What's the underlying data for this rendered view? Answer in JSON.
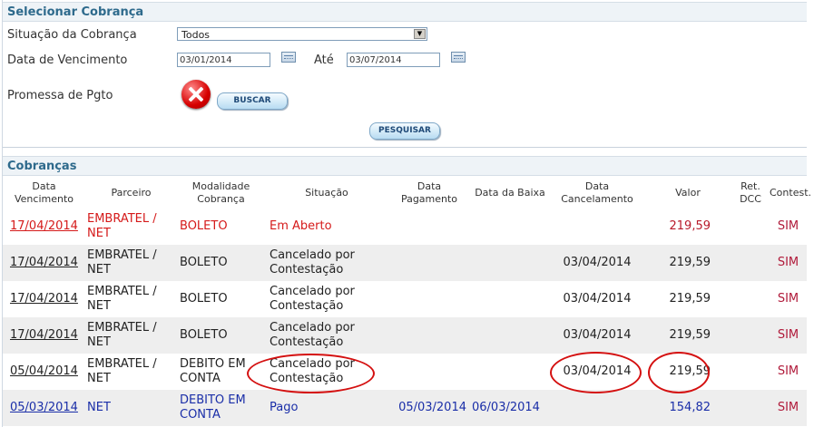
{
  "select_section": {
    "title": "Selecionar Cobrança",
    "situacao_label": "Situação da Cobrança",
    "situacao_value": "Todos",
    "vencimento_label": "Data de Vencimento",
    "vencimento_de": "03/01/2014",
    "ate_label": "Até",
    "vencimento_ate": "03/07/2014",
    "promessa_label": "Promessa de Pgto",
    "buscar_label": "BUSCAR",
    "pesquisar_label": "PESQUISAR"
  },
  "cobrancas": {
    "title": "Cobranças",
    "columns": {
      "vencimento": "Data Vencimento",
      "parceiro": "Parceiro",
      "modalidade": "Modalidade Cobrança",
      "situacao": "Situação",
      "pagamento": "Data Pagamento",
      "baixa": "Data da Baixa",
      "cancelamento": "Data Cancelamento",
      "valor": "Valor",
      "ret_dcc": "Ret. DCC",
      "contest": "Contest."
    },
    "rows": [
      {
        "vencimento": "17/04/2014",
        "parceiro": "EMBRATEL / NET",
        "modalidade": "BOLETO",
        "situacao": "Em Aberto",
        "pagamento": "",
        "baixa": "",
        "cancelamento": "",
        "valor": "219,59",
        "ret_dcc": "",
        "contest": "SIM"
      },
      {
        "vencimento": "17/04/2014",
        "parceiro": "EMBRATEL / NET",
        "modalidade": "BOLETO",
        "situacao": "Cancelado por Contestação",
        "pagamento": "",
        "baixa": "",
        "cancelamento": "03/04/2014",
        "valor": "219,59",
        "ret_dcc": "",
        "contest": "SIM"
      },
      {
        "vencimento": "17/04/2014",
        "parceiro": "EMBRATEL / NET",
        "modalidade": "BOLETO",
        "situacao": "Cancelado por Contestação",
        "pagamento": "",
        "baixa": "",
        "cancelamento": "03/04/2014",
        "valor": "219,59",
        "ret_dcc": "",
        "contest": "SIM"
      },
      {
        "vencimento": "17/04/2014",
        "parceiro": "EMBRATEL / NET",
        "modalidade": "BOLETO",
        "situacao": "Cancelado por Contestação",
        "pagamento": "",
        "baixa": "",
        "cancelamento": "03/04/2014",
        "valor": "219,59",
        "ret_dcc": "",
        "contest": "SIM"
      },
      {
        "vencimento": "05/04/2014",
        "parceiro": "EMBRATEL / NET",
        "modalidade": "DEBITO EM CONTA",
        "situacao": "Cancelado por Contestação",
        "pagamento": "",
        "baixa": "",
        "cancelamento": "03/04/2014",
        "valor": "219,59",
        "ret_dcc": "",
        "contest": "SIM"
      },
      {
        "vencimento": "05/03/2014",
        "parceiro": "NET",
        "modalidade": "DEBITO EM CONTA",
        "situacao": "Pago",
        "pagamento": "05/03/2014",
        "baixa": "06/03/2014",
        "cancelamento": "",
        "valor": "154,82",
        "ret_dcc": "",
        "contest": "SIM"
      }
    ]
  },
  "colors": {
    "header_text": "#2e6a8c",
    "open_row": "#d51a1a",
    "paid_row": "#1a2ea8",
    "annotation": "#d41010"
  }
}
